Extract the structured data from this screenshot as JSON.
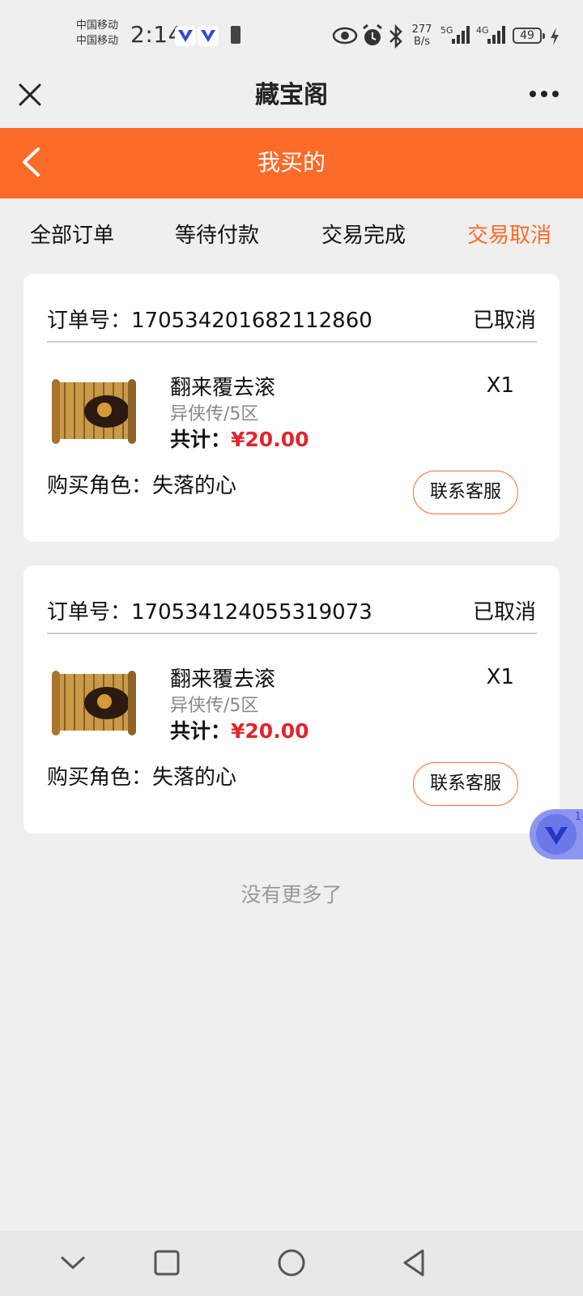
{
  "status_bar": {
    "carriers": [
      "中国移动",
      "中国移动"
    ],
    "time": "2:14",
    "network_speed": [
      "277",
      "B/s"
    ],
    "network_labels": [
      "5G",
      "4G"
    ],
    "battery_level": "49",
    "icons": [
      "vivo-v-icon",
      "vivo-v-icon",
      "battery-small-icon",
      "eye-icon",
      "alarm-icon",
      "bluetooth-icon",
      "signal-5g-icon",
      "signal-4g-icon",
      "battery-icon",
      "charging-icon"
    ]
  },
  "title_bar": {
    "title": "藏宝阁",
    "close_icon": "close-icon",
    "more_icon": "more-icon"
  },
  "header": {
    "title": "我买的",
    "back_icon": "back-icon",
    "color": "#fc6b27"
  },
  "tabs": [
    {
      "label": "全部订单",
      "active": false
    },
    {
      "label": "等待付款",
      "active": false
    },
    {
      "label": "交易完成",
      "active": false
    },
    {
      "label": "交易取消",
      "active": true
    }
  ],
  "orders": [
    {
      "order_label": "订单号：",
      "order_number": "170534201682112860",
      "status": "已取消",
      "item_name": "翻来覆去滚",
      "server": "异侠传/5区",
      "total_label": "共计：",
      "total_price": "¥20.00",
      "quantity": "X1",
      "role_label": "购买角色：",
      "role_name": "失落的心",
      "service_button": "联系客服"
    },
    {
      "order_label": "订单号：",
      "order_number": "170534124055319073",
      "status": "已取消",
      "item_name": "翻来覆去滚",
      "server": "异侠传/5区",
      "total_label": "共计：",
      "total_price": "¥20.00",
      "quantity": "X1",
      "role_label": "购买角色：",
      "role_name": "失落的心",
      "service_button": "联系客服"
    }
  ],
  "footer_note": "没有更多了",
  "floating_bubble": {
    "count": "1",
    "icon": "vivo-v-icon"
  },
  "navigation": [
    "collapse-icon",
    "recent-apps-icon",
    "home-icon",
    "back-triangle-icon"
  ],
  "colors": {
    "accent": "#fc6b27",
    "price": "#e0262d",
    "background": "#efefef"
  }
}
